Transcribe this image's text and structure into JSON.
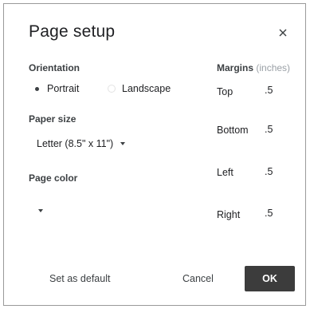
{
  "dialog": {
    "title": "Page setup",
    "close_icon": "close-icon"
  },
  "orientation": {
    "label": "Orientation",
    "options": [
      {
        "label": "Portrait",
        "checked": true
      },
      {
        "label": "Landscape",
        "checked": false
      }
    ]
  },
  "paper_size": {
    "label": "Paper size",
    "value": "Letter (8.5\" x 11\")"
  },
  "page_color": {
    "label": "Page color",
    "value_color": "#ffffff"
  },
  "margins": {
    "title": "Margins",
    "unit": "(inches)",
    "fields": [
      {
        "label": "Top",
        "value": ".5"
      },
      {
        "label": "Bottom",
        "value": ".5"
      },
      {
        "label": "Left",
        "value": ".5"
      },
      {
        "label": "Right",
        "value": ".5"
      }
    ]
  },
  "actions": {
    "set_default": "Set as default",
    "cancel": "Cancel",
    "ok": "OK"
  }
}
